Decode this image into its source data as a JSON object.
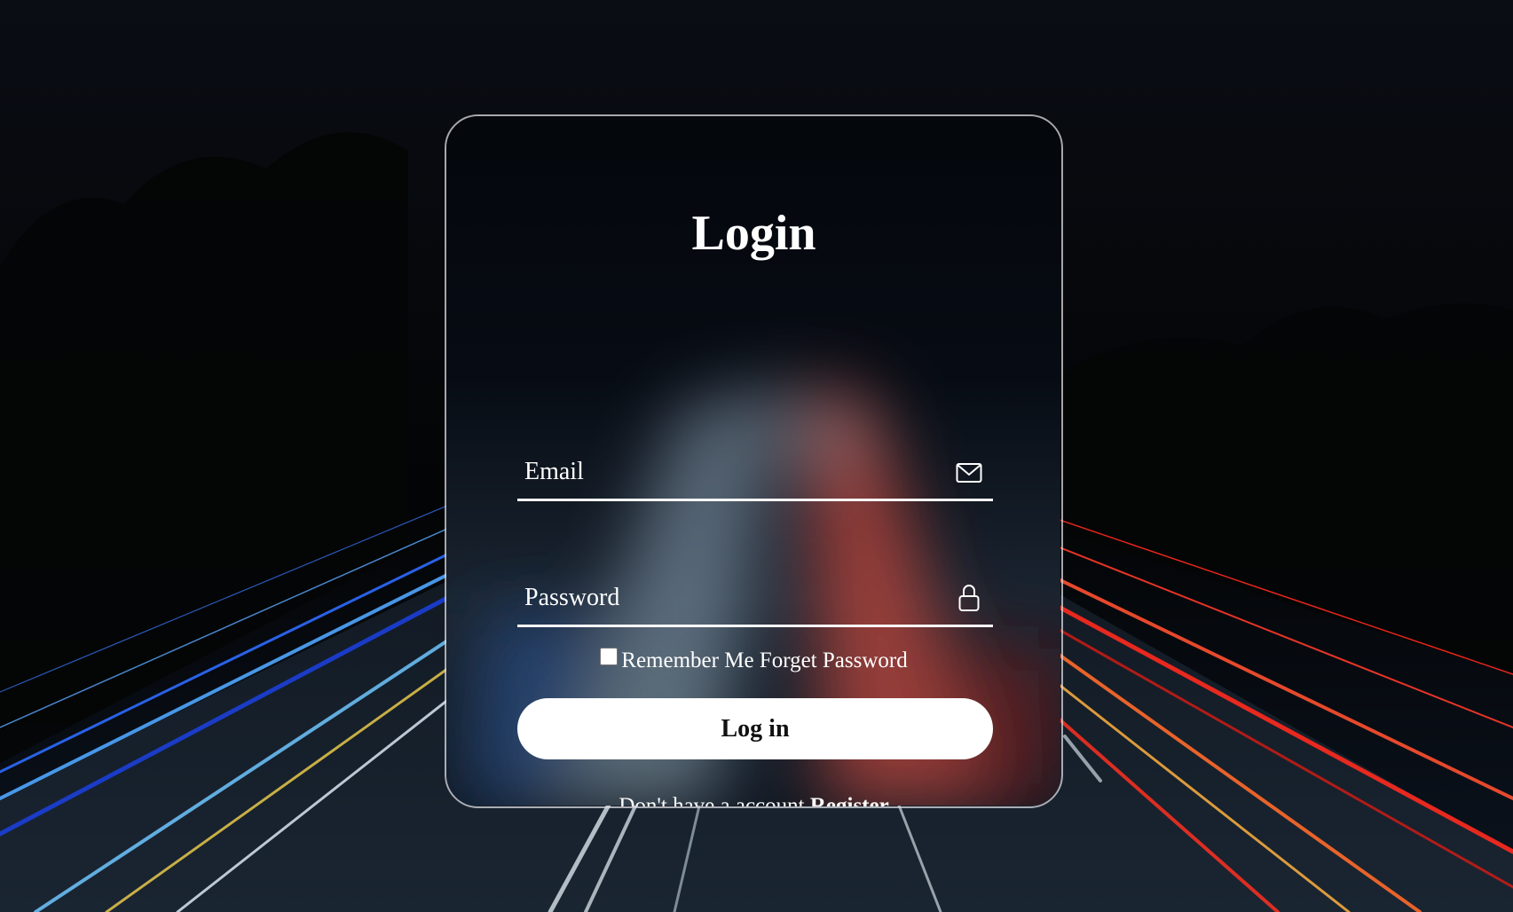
{
  "login_form": {
    "title": "Login",
    "email_placeholder": "Email",
    "password_placeholder": "Password",
    "remember_me_label": "Remember Me",
    "forgot_password_label": "Forget Password",
    "login_button_label": "Log in",
    "no_account_text": "Don't have a account",
    "register_link_label": "Register"
  },
  "icons": {
    "email": "envelope-icon",
    "password": "lock-icon"
  },
  "colors": {
    "page_background": "#050608",
    "card_border": "#dcdce1",
    "text": "#ffffff",
    "button_background": "#ffffff",
    "button_text": "#111111",
    "light_trail_left": "#3a7bff",
    "light_trail_right": "#ff3a2a"
  }
}
